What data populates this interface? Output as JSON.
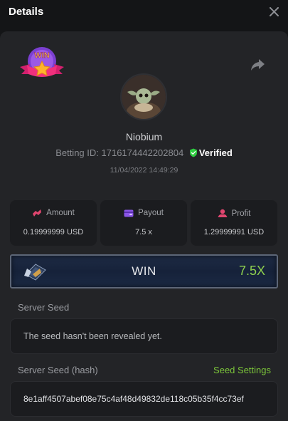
{
  "header": {
    "title": "Details"
  },
  "player": {
    "username": "Niobium",
    "betting_id_label": "Betting ID:",
    "betting_id": "1716174442202804",
    "verified_label": "Verified",
    "timestamp": "11/04/2022 14:49:29"
  },
  "badge": {
    "text": "WIN"
  },
  "stats": [
    {
      "label": "Amount",
      "value": "0.19999999 USD",
      "icon": "coins-icon",
      "color": "#e0466f"
    },
    {
      "label": "Payout",
      "value": "7.5 x",
      "icon": "wallet-icon",
      "color": "#8a55e6"
    },
    {
      "label": "Profit",
      "value": "1.29999991 USD",
      "icon": "profit-icon",
      "color": "#e0466f"
    }
  ],
  "result": {
    "label": "WIN",
    "multiplier": "7.5X"
  },
  "server_seed": {
    "label": "Server Seed",
    "value": "The seed hasn't been revealed yet."
  },
  "server_seed_hash": {
    "label": "Server Seed (hash)",
    "settings_link": "Seed Settings",
    "value": "8e1aff4507abef08e75c4af48d49832de118c05b35f4cc73ef"
  },
  "colors": {
    "accent_green": "#7cc63a",
    "multiplier_green": "#8fd14f",
    "verified_green": "#2ecc40"
  }
}
